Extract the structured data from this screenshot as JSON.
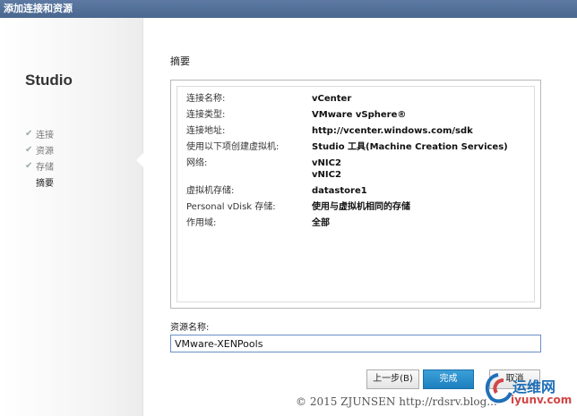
{
  "window": {
    "title": "添加连接和资源"
  },
  "sidebar": {
    "app_title": "Studio",
    "steps": [
      {
        "label": "连接",
        "completed": true
      },
      {
        "label": "资源",
        "completed": true
      },
      {
        "label": "存储",
        "completed": true
      },
      {
        "label": "摘要",
        "completed": false,
        "current": true
      }
    ]
  },
  "main": {
    "section_title": "摘要",
    "summary": [
      {
        "key": "连接名称:",
        "value": "vCenter"
      },
      {
        "key": "连接类型:",
        "value": "VMware vSphere®"
      },
      {
        "key": "连接地址:",
        "value": "http://vcenter.windows.com/sdk"
      },
      {
        "key": "使用以下项创建虚拟机:",
        "value": "Studio 工具(Machine Creation Services)"
      },
      {
        "key": "网络:",
        "value": "vNIC2",
        "value2": "vNIC2"
      },
      {
        "key": "虚拟机存储:",
        "value": "datastore1"
      },
      {
        "key": "Personal vDisk 存储:",
        "value": "使用与虚拟机相同的存储"
      },
      {
        "key": "作用域:",
        "value": "全部"
      }
    ],
    "resource_name_label": "资源名称:",
    "resource_name_value": "VMware-XENPools"
  },
  "buttons": {
    "back": "上一步(B)",
    "finish": "完成",
    "cancel": "取消"
  },
  "footer": {
    "copyright": "© 2015 ZJUNSEN http://rdsrv.blog..."
  },
  "watermark": {
    "line1": "运维网",
    "line2": "iyunv.com"
  },
  "colors": {
    "titlebar": "#4a6790",
    "accent": "#1d7fbf",
    "input_border": "#6a8fc7"
  }
}
